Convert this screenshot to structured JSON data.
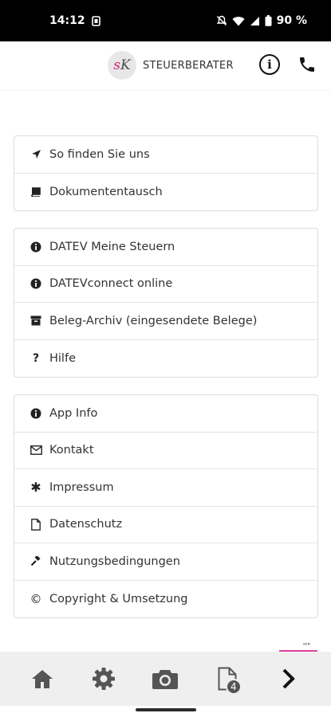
{
  "status": {
    "time": "14:12",
    "battery": "90 %"
  },
  "app": {
    "brand": "STEUERBERATER"
  },
  "groups": [
    [
      {
        "label": "So finden Sie uns",
        "icon": "location-arrow-icon"
      },
      {
        "label": "Dokumententausch",
        "icon": "book-icon"
      }
    ],
    [
      {
        "label": "DATEV Meine Steuern",
        "icon": "info-circle-icon"
      },
      {
        "label": "DATEVconnect online",
        "icon": "info-circle-icon"
      },
      {
        "label": "Beleg-Archiv (eingesendete Belege)",
        "icon": "archive-icon"
      },
      {
        "label": "Hilfe",
        "icon": "question-icon"
      }
    ],
    [
      {
        "label": "App Info",
        "icon": "info-circle-icon"
      },
      {
        "label": "Kontakt",
        "icon": "envelope-icon"
      },
      {
        "label": "Impressum",
        "icon": "asterisk-icon"
      },
      {
        "label": "Datenschutz",
        "icon": "file-icon"
      },
      {
        "label": "Nutzungsbedingungen",
        "icon": "gavel-icon"
      },
      {
        "label": "Copyright & Umsetzung",
        "icon": "copyright-icon"
      }
    ]
  ],
  "bottom_nav": {
    "documents_badge": "4"
  }
}
